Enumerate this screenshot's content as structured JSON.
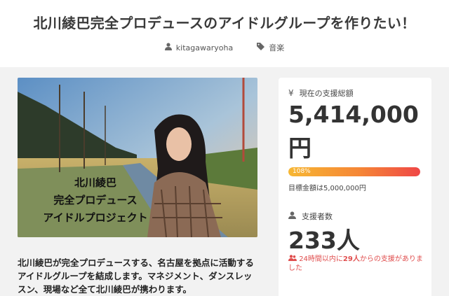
{
  "header": {
    "title": "北川綾巴完全プロデュースのアイドルグループを作りたい！",
    "author": "kitagawaryoha",
    "category": "音楽"
  },
  "hero": {
    "caption_lines": [
      "北川綾巴",
      "完全プロデュース",
      "アイドルプロジェクト"
    ]
  },
  "description": "北川綾巴が完全プロデュースする、名古屋を拠点に活動するアイドルグループを結成します。マネジメント、ダンスレッスン、現場など全て北川綾巴が携わります。",
  "sidebar": {
    "total_label": "現在の支援総額",
    "amount": "5,414,000",
    "amount_unit": "円",
    "progress_percent": 108,
    "progress_label": "108%",
    "goal": "目標金額は5,000,000円",
    "backers_label": "支援者数",
    "backers": "233人",
    "recent_prefix": "24時間以内に",
    "recent_count": "29人",
    "recent_suffix": "からの支援がありました"
  },
  "colors": {
    "progress_start": "#f7b733",
    "progress_end": "#ef4747",
    "alert": "#e04e4e"
  }
}
